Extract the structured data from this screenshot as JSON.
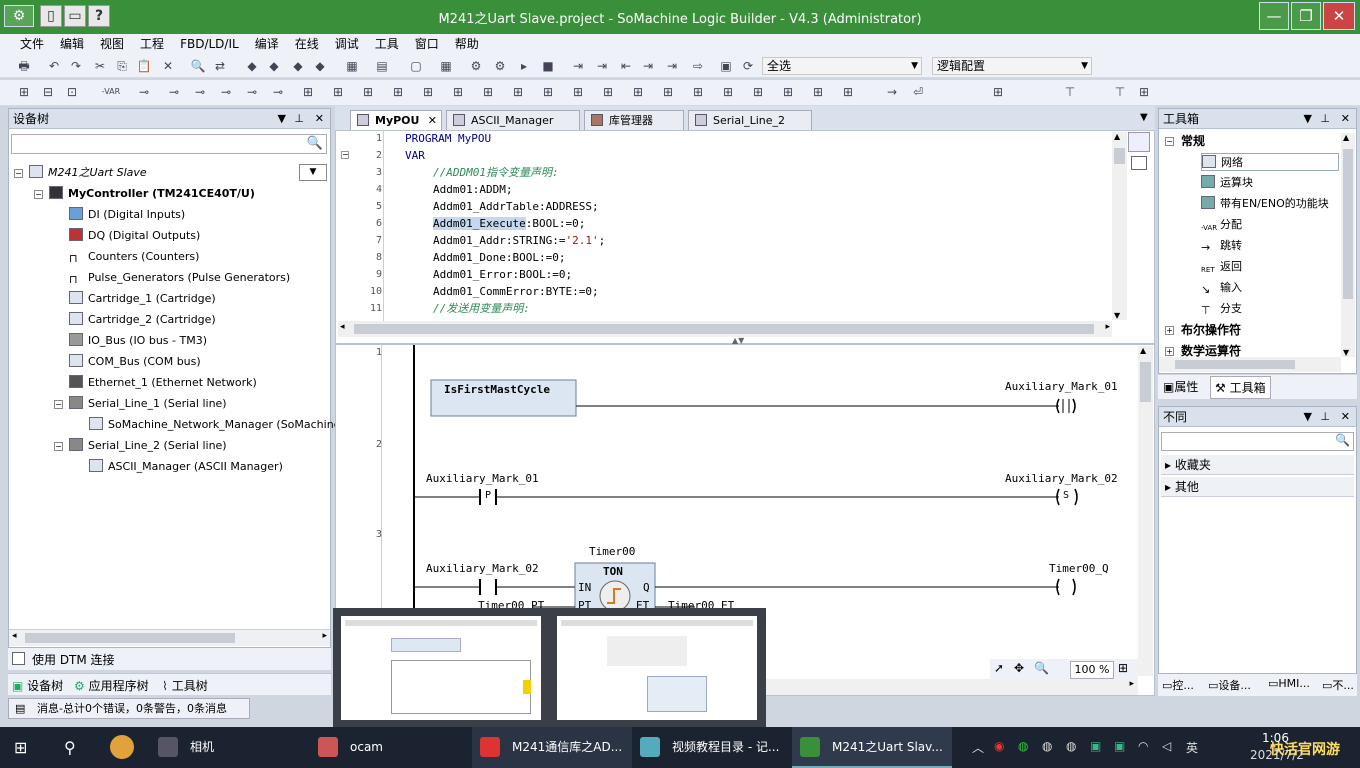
{
  "window": {
    "title": "M241之Uart Slave.project - SoMachine Logic Builder - V4.3 (Administrator)",
    "btn_min": "—",
    "btn_max": "❐",
    "btn_close": "✕",
    "qa_help": "?"
  },
  "menu": [
    "文件",
    "编辑",
    "视图",
    "工程",
    "FBD/LD/IL",
    "编译",
    "在线",
    "调试",
    "工具",
    "窗口",
    "帮助"
  ],
  "toolbar": {
    "select_all": "全选",
    "config": "逻辑配置"
  },
  "device_tree": {
    "title": "设备树",
    "root": "M241之Uart Slave",
    "controller": "MyController (TM241CE40T/U)",
    "items": [
      "DI (Digital Inputs)",
      "DQ (Digital Outputs)",
      "Counters (Counters)",
      "Pulse_Generators (Pulse Generators)",
      "Cartridge_1 (Cartridge)",
      "Cartridge_2 (Cartridge)",
      "IO_Bus (IO bus - TM3)",
      "COM_Bus (COM bus)",
      "Ethernet_1 (Ethernet Network)",
      "Serial_Line_1 (Serial line)",
      "SoMachine_Network_Manager (SoMachine-Ne",
      "Serial_Line_2 (Serial line)",
      "ASCII_Manager (ASCII Manager)"
    ],
    "dtm_label": "使用 DTM 连接",
    "bottom_tabs": [
      "设备树",
      "应用程序树",
      "工具树"
    ],
    "status": "消息-总计0个错误，0条警告，0条消息"
  },
  "editor": {
    "tabs": [
      "MyPOU",
      "ASCII_Manager",
      "库管理器",
      "Serial_Line_2"
    ],
    "line_numbers": [
      "1",
      "2",
      "3",
      "4",
      "5",
      "6",
      "7",
      "8",
      "9",
      "10",
      "11"
    ],
    "code": {
      "l1": "PROGRAM MyPOU",
      "l2": "VAR",
      "l3": "//ADDM01指令变量声明:",
      "l4": "Addm01:ADDM;",
      "l5": "Addm01_AddrTable:ADDRESS;",
      "l6a": "Addm01_Execute",
      "l6b": ":BOOL:=0;",
      "l7a": "Addm01_Addr:STRING:=",
      "l7b": "'2.1'",
      "l7c": ";",
      "l8": "Addm01_Done:BOOL:=0;",
      "l9": "Addm01_Error:BOOL:=0;",
      "l10": "Addm01_CommError:BYTE:=0;",
      "l11": "//发送用变量声明:"
    },
    "ladder": {
      "rung_numbers": [
        "1",
        "2",
        "3"
      ],
      "first_cycle": "IsFirstMastCycle",
      "aux1": "Auxiliary_Mark_01",
      "aux2": "Auxiliary_Mark_02",
      "p_contact": "P",
      "s_coil": "S",
      "timer_name": "Timer00",
      "timer_type": "TON",
      "in": "IN",
      "q": "Q",
      "pt": "PT",
      "et": "ET",
      "timer_q": "Timer00_Q",
      "timer_pt": "Timer00_PT",
      "timer_et": "Timer00_ET"
    },
    "zoom": "100 %"
  },
  "toolbox": {
    "title": "工具箱",
    "group": "常规",
    "items": [
      "网络",
      "运算块",
      "带有EN/ENO的功能块",
      "分配",
      "跳转",
      "返回",
      "输入",
      "分支"
    ],
    "groups2": [
      "布尔操作符",
      "数学运算符"
    ],
    "tabs": [
      "属性",
      "工具箱"
    ]
  },
  "diff": {
    "title": "不同",
    "items": [
      "收藏夹",
      "其他"
    ]
  },
  "right_bottom_tabs": [
    "控...",
    "设备...",
    "HMI...",
    "不..."
  ],
  "taskbar": {
    "apps": [
      "相机",
      "ocam",
      "M241通信库之AD...",
      "视频教程目录 - 记...",
      "M241之Uart Slav..."
    ],
    "ime": "英",
    "time": "1:06",
    "date": "2021/7/2"
  },
  "watermark": "快活官网游"
}
